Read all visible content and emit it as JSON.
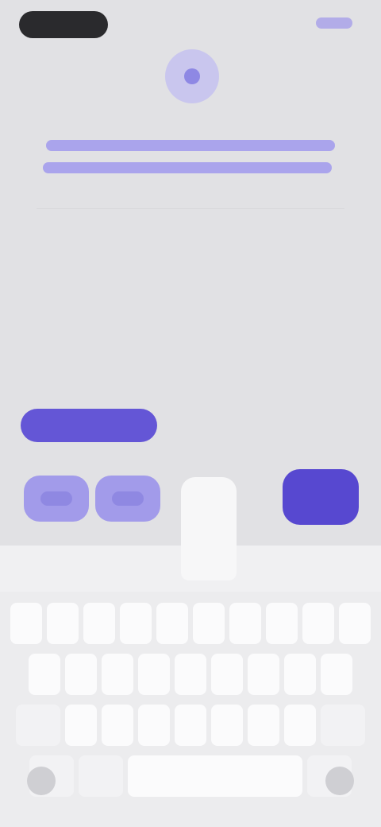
{
  "status_bar": {
    "pill_label": "",
    "right_link": ""
  },
  "header": {
    "title_line_1": "",
    "title_line_2": ""
  },
  "actions": {
    "primary_label": "",
    "chips": [
      "",
      ""
    ],
    "send_label": ""
  },
  "keyboard": {
    "popup_key": "",
    "rows": [
      [
        "",
        "",
        "",
        "",
        "",
        "",
        "",
        "",
        "",
        ""
      ],
      [
        "",
        "",
        "",
        "",
        "",
        "",
        "",
        "",
        ""
      ],
      [
        "",
        "",
        "",
        "",
        "",
        "",
        "",
        "",
        ""
      ],
      [
        "",
        "",
        "",
        ""
      ]
    ]
  },
  "colors": {
    "accent": "#5748d0",
    "accent_light": "#a29bea",
    "background": "#e1e1e4",
    "keyboard_bg": "#ececee"
  },
  "icons": {
    "logo": "app-logo-icon",
    "bottom_left": "globe-icon",
    "bottom_right": "microphone-icon"
  }
}
